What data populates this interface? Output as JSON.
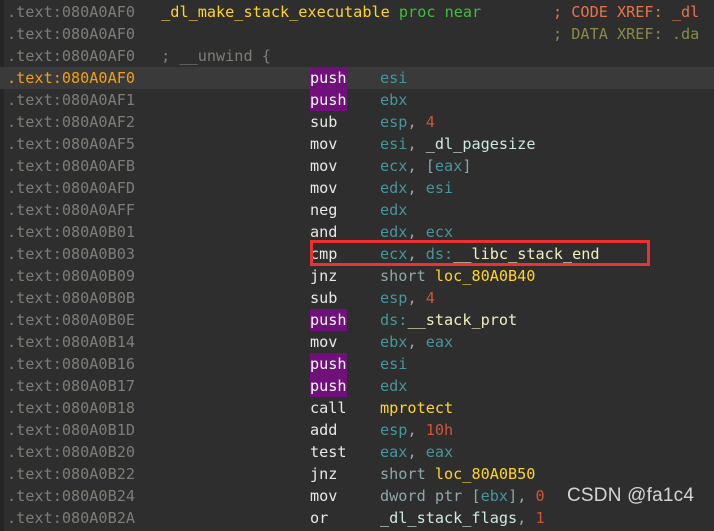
{
  "view": {
    "title": "IDA View-A (disassembly)",
    "segment_prefix": ".text:",
    "background_color": "#2e2e2e",
    "cursor_line_color": "#3a3a3a",
    "highlight_color": "#70107a",
    "annotation_box_color": "#f03030"
  },
  "watermark": {
    "text": "CSDN @fa1c4"
  },
  "comments": {
    "code_xref": "; CODE XREF: _dl",
    "data_xref": "; DATA XREF: .da"
  },
  "lines": [
    {
      "address": "080A0AF0",
      "cursor": false,
      "kind": "proc-header",
      "function_name": "_dl_make_stack_executable",
      "keyword": "proc near"
    },
    {
      "address": "080A0AF0",
      "cursor": false,
      "kind": "blank"
    },
    {
      "address": "080A0AF0",
      "cursor": false,
      "kind": "comment",
      "comment": "; __unwind {"
    },
    {
      "address": "080A0AF0",
      "cursor": true,
      "kind": "insn",
      "mnemonic": "push",
      "mnemonic_highlighted": true,
      "operands": "esi"
    },
    {
      "address": "080A0AF1",
      "cursor": false,
      "kind": "insn",
      "mnemonic": "push",
      "mnemonic_highlighted": true,
      "operands": "ebx"
    },
    {
      "address": "080A0AF2",
      "cursor": false,
      "kind": "insn",
      "mnemonic": "sub",
      "mnemonic_highlighted": false,
      "operands": "esp, 4"
    },
    {
      "address": "080A0AF5",
      "cursor": false,
      "kind": "insn",
      "mnemonic": "mov",
      "mnemonic_highlighted": false,
      "operands": "esi, _dl_pagesize"
    },
    {
      "address": "080A0AFB",
      "cursor": false,
      "kind": "insn",
      "mnemonic": "mov",
      "mnemonic_highlighted": false,
      "operands": "ecx, [eax]"
    },
    {
      "address": "080A0AFD",
      "cursor": false,
      "kind": "insn",
      "mnemonic": "mov",
      "mnemonic_highlighted": false,
      "operands": "edx, esi"
    },
    {
      "address": "080A0AFF",
      "cursor": false,
      "kind": "insn",
      "mnemonic": "neg",
      "mnemonic_highlighted": false,
      "operands": "edx"
    },
    {
      "address": "080A0B01",
      "cursor": false,
      "kind": "insn",
      "mnemonic": "and",
      "mnemonic_highlighted": false,
      "operands": "edx, ecx"
    },
    {
      "address": "080A0B03",
      "cursor": false,
      "kind": "insn",
      "mnemonic": "cmp",
      "mnemonic_highlighted": false,
      "operands": "ecx, ds:__libc_stack_end",
      "boxed": true
    },
    {
      "address": "080A0B09",
      "cursor": false,
      "kind": "insn",
      "mnemonic": "jnz",
      "mnemonic_highlighted": false,
      "operands": "short loc_80A0B40"
    },
    {
      "address": "080A0B0B",
      "cursor": false,
      "kind": "insn",
      "mnemonic": "sub",
      "mnemonic_highlighted": false,
      "operands": "esp, 4"
    },
    {
      "address": "080A0B0E",
      "cursor": false,
      "kind": "insn",
      "mnemonic": "push",
      "mnemonic_highlighted": true,
      "operands": "ds:__stack_prot"
    },
    {
      "address": "080A0B14",
      "cursor": false,
      "kind": "insn",
      "mnemonic": "mov",
      "mnemonic_highlighted": false,
      "operands": "ebx, eax"
    },
    {
      "address": "080A0B16",
      "cursor": false,
      "kind": "insn",
      "mnemonic": "push",
      "mnemonic_highlighted": true,
      "operands": "esi"
    },
    {
      "address": "080A0B17",
      "cursor": false,
      "kind": "insn",
      "mnemonic": "push",
      "mnemonic_highlighted": true,
      "operands": "edx"
    },
    {
      "address": "080A0B18",
      "cursor": false,
      "kind": "insn",
      "mnemonic": "call",
      "mnemonic_highlighted": false,
      "operands": "mprotect"
    },
    {
      "address": "080A0B1D",
      "cursor": false,
      "kind": "insn",
      "mnemonic": "add",
      "mnemonic_highlighted": false,
      "operands": "esp, 10h"
    },
    {
      "address": "080A0B20",
      "cursor": false,
      "kind": "insn",
      "mnemonic": "test",
      "mnemonic_highlighted": false,
      "operands": "eax, eax"
    },
    {
      "address": "080A0B22",
      "cursor": false,
      "kind": "insn",
      "mnemonic": "jnz",
      "mnemonic_highlighted": false,
      "operands": "short loc_80A0B50"
    },
    {
      "address": "080A0B24",
      "cursor": false,
      "kind": "insn",
      "mnemonic": "mov",
      "mnemonic_highlighted": false,
      "operands": "dword ptr [ebx], 0"
    },
    {
      "address": "080A0B2A",
      "cursor": false,
      "kind": "insn",
      "mnemonic": "or",
      "mnemonic_highlighted": false,
      "operands": "_dl_stack_flags, 1"
    }
  ]
}
